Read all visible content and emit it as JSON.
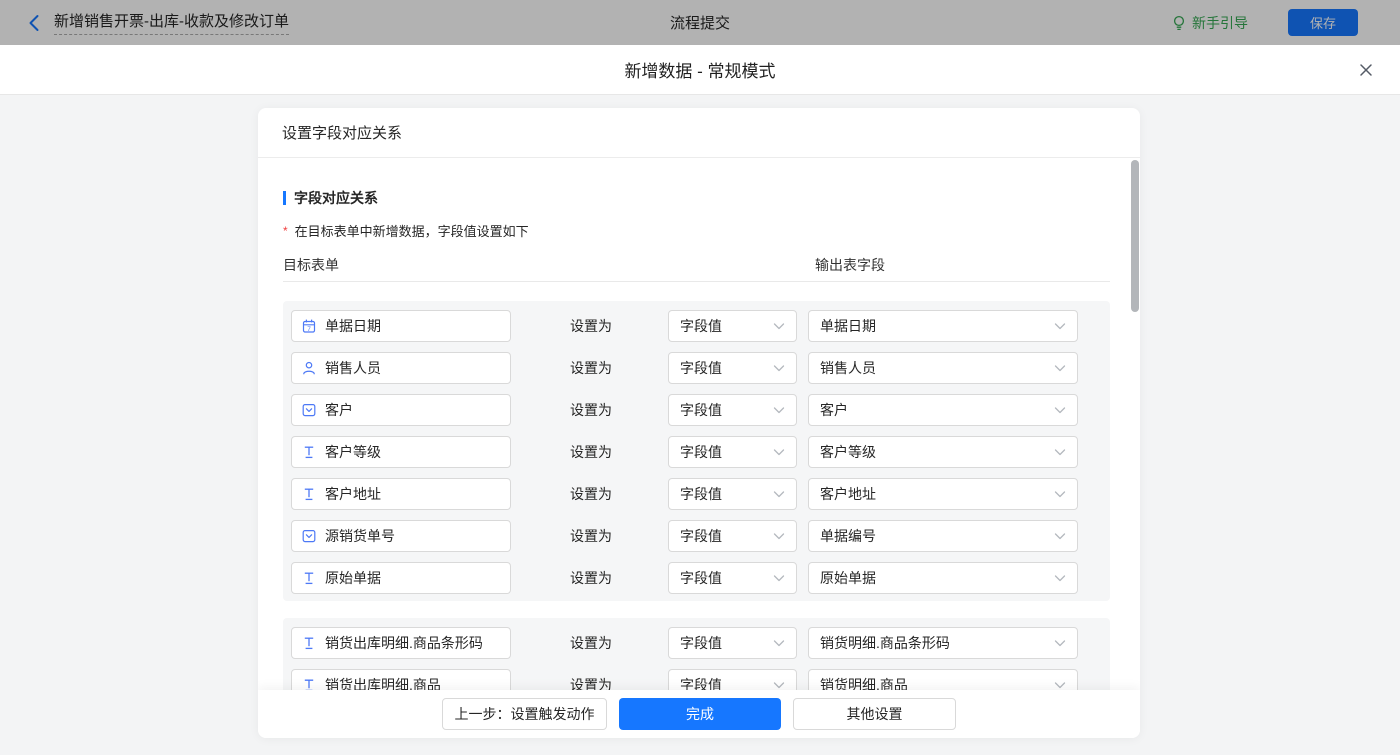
{
  "topbar": {
    "back_title": "新增销售开票-出库-收款及修改订单",
    "center_title": "流程提交",
    "guide_label": "新手引导",
    "save_label": "保存"
  },
  "modal": {
    "title": "新增数据 - 常规模式"
  },
  "card": {
    "header": "设置字段对应关系",
    "section_title": "字段对应关系",
    "required_mark": "*",
    "note_text": "在目标表单中新增数据，字段值设置如下",
    "columns": {
      "target": "目标表单",
      "output": "输出表字段"
    },
    "set_as_label": "设置为",
    "groups": [
      {
        "rows": [
          {
            "icon": "date",
            "target": "单据日期",
            "mode": "字段值",
            "output": "单据日期"
          },
          {
            "icon": "user",
            "target": "销售人员",
            "mode": "字段值",
            "output": "销售人员"
          },
          {
            "icon": "select",
            "target": "客户",
            "mode": "字段值",
            "output": "客户"
          },
          {
            "icon": "text",
            "target": "客户等级",
            "mode": "字段值",
            "output": "客户等级"
          },
          {
            "icon": "text",
            "target": "客户地址",
            "mode": "字段值",
            "output": "客户地址"
          },
          {
            "icon": "select",
            "target": "源销货单号",
            "mode": "字段值",
            "output": "单据编号"
          },
          {
            "icon": "text",
            "target": "原始单据",
            "mode": "字段值",
            "output": "原始单据"
          }
        ]
      },
      {
        "rows": [
          {
            "icon": "text",
            "target": "销货出库明细.商品条形码",
            "mode": "字段值",
            "output": "销货明细.商品条形码"
          },
          {
            "icon": "text",
            "target": "销货出库明细.商品",
            "mode": "字段值",
            "output": "销货明细.商品"
          }
        ]
      }
    ],
    "footer": {
      "prev_label": "上一步：设置触发动作",
      "done_label": "完成",
      "other_label": "其他设置"
    }
  },
  "colors": {
    "accent_blue": "#1677ff",
    "field_icon_blue": "#4d79f6",
    "guide_green": "#36a854",
    "page_bg": "#f3f4f5",
    "group_bg": "#f5f6f7"
  }
}
